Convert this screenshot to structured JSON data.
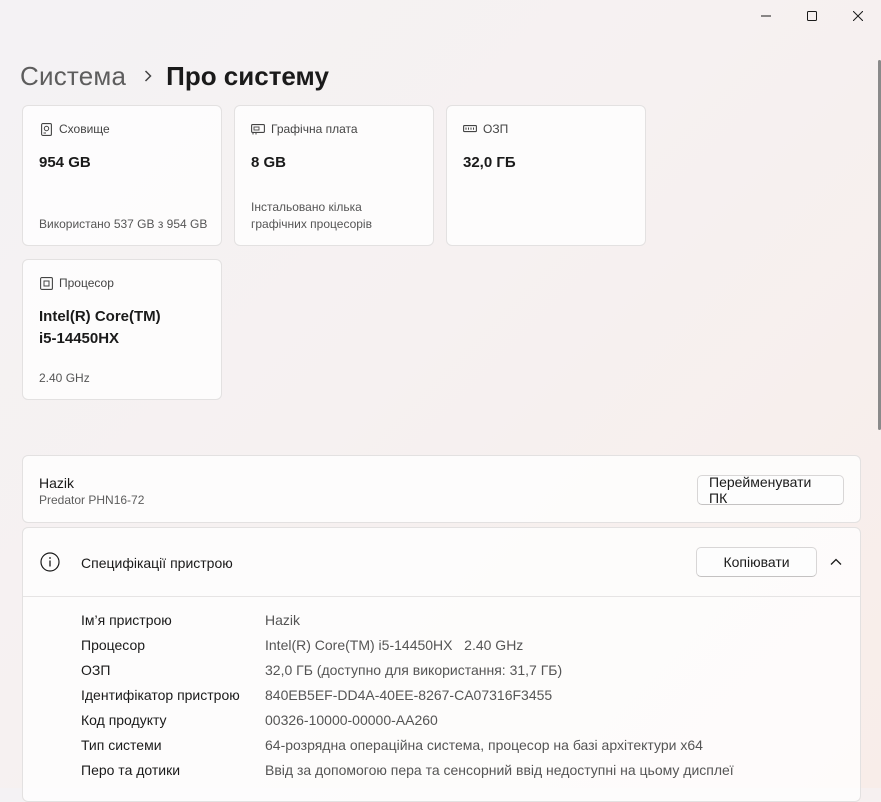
{
  "window": {
    "controls": [
      "minimize",
      "maximize",
      "close"
    ]
  },
  "breadcrumb": {
    "parent": "Система",
    "current": "Про систему"
  },
  "cards": {
    "storage": {
      "label": "Сховище",
      "value": "954 GB",
      "sub": "Використано 537 GB з 954 GB",
      "icon": "storage-icon"
    },
    "gpu": {
      "label": "Графічна плата",
      "value": "8 GB",
      "sub1": "Інстальовано кілька",
      "sub2": "графічних процесорів",
      "icon": "gpu-icon"
    },
    "ram": {
      "label": "ОЗП",
      "value": "32,0 ГБ",
      "icon": "ram-icon"
    },
    "cpu": {
      "label": "Процесор",
      "value1": "Intel(R) Core(TM)",
      "value2": "i5-14450HX",
      "sub": "2.40 GHz",
      "icon": "cpu-icon"
    }
  },
  "device": {
    "name": "Hazik",
    "model": "Predator PHN16-72",
    "rename_button": "Перейменувати ПК"
  },
  "specs": {
    "title": "Специфікації пристрою",
    "copy_button": "Копіювати",
    "rows": [
      {
        "key": "Ім’я пристрою",
        "value": "Hazik"
      },
      {
        "key": "Процесор",
        "value": "Intel(R) Core(TM) i5-14450HX   2.40 GHz"
      },
      {
        "key": "ОЗП",
        "value": "32,0 ГБ (доступно для використання: 31,7 ГБ)"
      },
      {
        "key": "Ідентифікатор пристрою",
        "value": "840EB5EF-DD4A-40EE-8267-CA07316F3455"
      },
      {
        "key": "Код продукту",
        "value": "00326-10000-00000-AA260"
      },
      {
        "key": "Тип системи",
        "value": "64-розрядна операційна система, процесор на базі архітектури x64"
      },
      {
        "key": "Перо та дотики",
        "value": "Ввід за допомогою пера та сенсорний ввід недоступні на цьому дисплеї"
      }
    ]
  }
}
